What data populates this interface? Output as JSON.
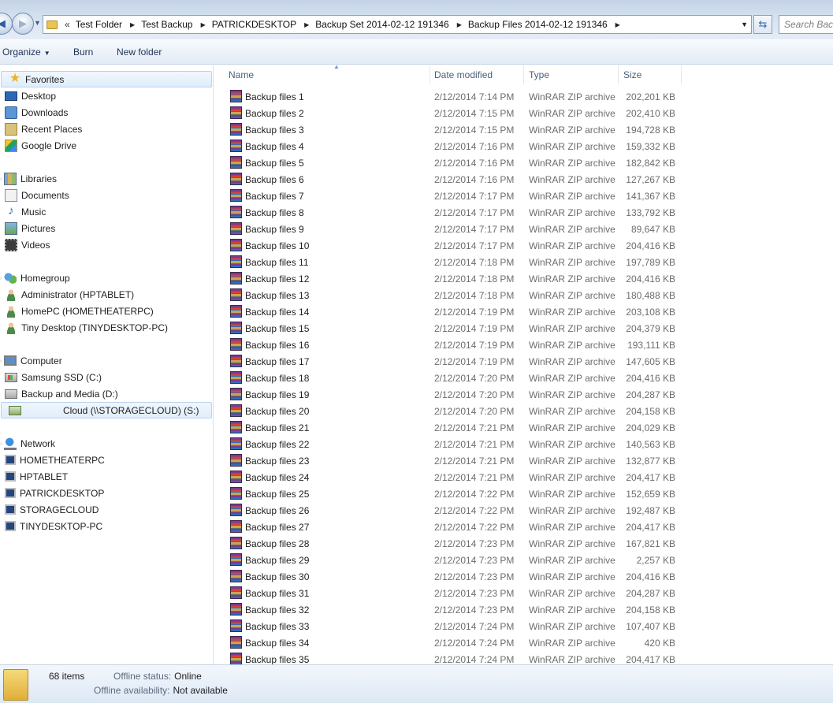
{
  "address_bar": {
    "overflow_chevron": "«",
    "breadcrumbs": [
      "Test Folder",
      "Test Backup",
      "PATRICKDESKTOP",
      "Backup Set 2014-02-12 191346",
      "Backup Files 2014-02-12 191346"
    ],
    "search_placeholder": "Search Back"
  },
  "toolbar": {
    "organize_label": "Organize",
    "burn_label": "Burn",
    "new_folder_label": "New folder"
  },
  "nav": {
    "favorites": {
      "label": "Favorites",
      "items": [
        "Desktop",
        "Downloads",
        "Recent Places",
        "Google Drive"
      ]
    },
    "libraries": {
      "label": "Libraries",
      "items": [
        "Documents",
        "Music",
        "Pictures",
        "Videos"
      ]
    },
    "homegroup": {
      "label": "Homegroup",
      "items": [
        "Administrator (HPTABLET)",
        "HomePC (HOMETHEATERPC)",
        "Tiny Desktop (TINYDESKTOP-PC)"
      ]
    },
    "computer": {
      "label": "Computer",
      "items": [
        "Samsung SSD (C:)",
        "Backup and Media (D:)",
        "Cloud (\\\\STORAGECLOUD) (S:)"
      ]
    },
    "network": {
      "label": "Network",
      "items": [
        "HOMETHEATERPC",
        "HPTABLET",
        "PATRICKDESKTOP",
        "STORAGECLOUD",
        "TINYDESKTOP-PC"
      ]
    }
  },
  "columns": {
    "name": "Name",
    "date": "Date modified",
    "type": "Type",
    "size": "Size"
  },
  "files": [
    {
      "name": "Backup files 1",
      "date": "2/12/2014 7:14 PM",
      "type": "WinRAR ZIP archive",
      "size": "202,201 KB"
    },
    {
      "name": "Backup files 2",
      "date": "2/12/2014 7:15 PM",
      "type": "WinRAR ZIP archive",
      "size": "202,410 KB"
    },
    {
      "name": "Backup files 3",
      "date": "2/12/2014 7:15 PM",
      "type": "WinRAR ZIP archive",
      "size": "194,728 KB"
    },
    {
      "name": "Backup files 4",
      "date": "2/12/2014 7:16 PM",
      "type": "WinRAR ZIP archive",
      "size": "159,332 KB"
    },
    {
      "name": "Backup files 5",
      "date": "2/12/2014 7:16 PM",
      "type": "WinRAR ZIP archive",
      "size": "182,842 KB"
    },
    {
      "name": "Backup files 6",
      "date": "2/12/2014 7:16 PM",
      "type": "WinRAR ZIP archive",
      "size": "127,267 KB"
    },
    {
      "name": "Backup files 7",
      "date": "2/12/2014 7:17 PM",
      "type": "WinRAR ZIP archive",
      "size": "141,367 KB"
    },
    {
      "name": "Backup files 8",
      "date": "2/12/2014 7:17 PM",
      "type": "WinRAR ZIP archive",
      "size": "133,792 KB"
    },
    {
      "name": "Backup files 9",
      "date": "2/12/2014 7:17 PM",
      "type": "WinRAR ZIP archive",
      "size": "89,647 KB"
    },
    {
      "name": "Backup files 10",
      "date": "2/12/2014 7:17 PM",
      "type": "WinRAR ZIP archive",
      "size": "204,416 KB"
    },
    {
      "name": "Backup files 11",
      "date": "2/12/2014 7:18 PM",
      "type": "WinRAR ZIP archive",
      "size": "197,789 KB"
    },
    {
      "name": "Backup files 12",
      "date": "2/12/2014 7:18 PM",
      "type": "WinRAR ZIP archive",
      "size": "204,416 KB"
    },
    {
      "name": "Backup files 13",
      "date": "2/12/2014 7:18 PM",
      "type": "WinRAR ZIP archive",
      "size": "180,488 KB"
    },
    {
      "name": "Backup files 14",
      "date": "2/12/2014 7:19 PM",
      "type": "WinRAR ZIP archive",
      "size": "203,108 KB"
    },
    {
      "name": "Backup files 15",
      "date": "2/12/2014 7:19 PM",
      "type": "WinRAR ZIP archive",
      "size": "204,379 KB"
    },
    {
      "name": "Backup files 16",
      "date": "2/12/2014 7:19 PM",
      "type": "WinRAR ZIP archive",
      "size": "193,111 KB"
    },
    {
      "name": "Backup files 17",
      "date": "2/12/2014 7:19 PM",
      "type": "WinRAR ZIP archive",
      "size": "147,605 KB"
    },
    {
      "name": "Backup files 18",
      "date": "2/12/2014 7:20 PM",
      "type": "WinRAR ZIP archive",
      "size": "204,416 KB"
    },
    {
      "name": "Backup files 19",
      "date": "2/12/2014 7:20 PM",
      "type": "WinRAR ZIP archive",
      "size": "204,287 KB"
    },
    {
      "name": "Backup files 20",
      "date": "2/12/2014 7:20 PM",
      "type": "WinRAR ZIP archive",
      "size": "204,158 KB"
    },
    {
      "name": "Backup files 21",
      "date": "2/12/2014 7:21 PM",
      "type": "WinRAR ZIP archive",
      "size": "204,029 KB"
    },
    {
      "name": "Backup files 22",
      "date": "2/12/2014 7:21 PM",
      "type": "WinRAR ZIP archive",
      "size": "140,563 KB"
    },
    {
      "name": "Backup files 23",
      "date": "2/12/2014 7:21 PM",
      "type": "WinRAR ZIP archive",
      "size": "132,877 KB"
    },
    {
      "name": "Backup files 24",
      "date": "2/12/2014 7:21 PM",
      "type": "WinRAR ZIP archive",
      "size": "204,417 KB"
    },
    {
      "name": "Backup files 25",
      "date": "2/12/2014 7:22 PM",
      "type": "WinRAR ZIP archive",
      "size": "152,659 KB"
    },
    {
      "name": "Backup files 26",
      "date": "2/12/2014 7:22 PM",
      "type": "WinRAR ZIP archive",
      "size": "192,487 KB"
    },
    {
      "name": "Backup files 27",
      "date": "2/12/2014 7:22 PM",
      "type": "WinRAR ZIP archive",
      "size": "204,417 KB"
    },
    {
      "name": "Backup files 28",
      "date": "2/12/2014 7:23 PM",
      "type": "WinRAR ZIP archive",
      "size": "167,821 KB"
    },
    {
      "name": "Backup files 29",
      "date": "2/12/2014 7:23 PM",
      "type": "WinRAR ZIP archive",
      "size": "2,257 KB"
    },
    {
      "name": "Backup files 30",
      "date": "2/12/2014 7:23 PM",
      "type": "WinRAR ZIP archive",
      "size": "204,416 KB"
    },
    {
      "name": "Backup files 31",
      "date": "2/12/2014 7:23 PM",
      "type": "WinRAR ZIP archive",
      "size": "204,287 KB"
    },
    {
      "name": "Backup files 32",
      "date": "2/12/2014 7:23 PM",
      "type": "WinRAR ZIP archive",
      "size": "204,158 KB"
    },
    {
      "name": "Backup files 33",
      "date": "2/12/2014 7:24 PM",
      "type": "WinRAR ZIP archive",
      "size": "107,407 KB"
    },
    {
      "name": "Backup files 34",
      "date": "2/12/2014 7:24 PM",
      "type": "WinRAR ZIP archive",
      "size": "420 KB"
    },
    {
      "name": "Backup files 35",
      "date": "2/12/2014 7:24 PM",
      "type": "WinRAR ZIP archive",
      "size": "204,417 KB"
    }
  ],
  "details": {
    "item_count": "68 items",
    "offline_status_label": "Offline status:",
    "offline_status_value": "Online",
    "offline_availability_label": "Offline availability:",
    "offline_availability_value": "Not available"
  }
}
